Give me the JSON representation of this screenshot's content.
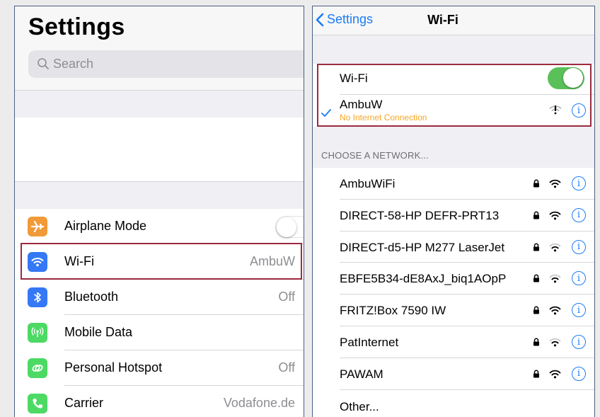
{
  "left": {
    "title": "Settings",
    "search_placeholder": "Search",
    "items": [
      {
        "label": "Airplane Mode",
        "value": "",
        "icon": "airplane-icon",
        "color": "#f19a37",
        "toggle": "off"
      },
      {
        "label": "Wi-Fi",
        "value": "AmbuW",
        "icon": "wifi-icon",
        "color": "#3478f6"
      },
      {
        "label": "Bluetooth",
        "value": "Off",
        "icon": "bluetooth-icon",
        "color": "#3478f6"
      },
      {
        "label": "Mobile Data",
        "value": "",
        "icon": "antenna-icon",
        "color": "#4cd964"
      },
      {
        "label": "Personal Hotspot",
        "value": "Off",
        "icon": "hotspot-icon",
        "color": "#4cd964"
      },
      {
        "label": "Carrier",
        "value": "Vodafone.de",
        "icon": "phone-icon",
        "color": "#4cd964"
      }
    ]
  },
  "right": {
    "back_label": "Settings",
    "title": "Wi-Fi",
    "wifi_label": "Wi-Fi",
    "wifi_toggle": "on",
    "connected": {
      "name": "AmbuW",
      "status": "No Internet Connection",
      "status_color": "#f5a623"
    },
    "section_header": "CHOOSE A NETWORK...",
    "networks": [
      {
        "name": "AmbuWiFi",
        "locked": true,
        "signal": "full"
      },
      {
        "name": "DIRECT-58-HP DEFR-PRT13",
        "locked": true,
        "signal": "full"
      },
      {
        "name": "DIRECT-d5-HP M277 LaserJet",
        "locked": true,
        "signal": "weak"
      },
      {
        "name": "EBFE5B34-dE8AxJ_biq1AOpP",
        "locked": true,
        "signal": "weak"
      },
      {
        "name": "FRITZ!Box 7590 IW",
        "locked": true,
        "signal": "full"
      },
      {
        "name": "PatInternet",
        "locked": true,
        "signal": "weak"
      },
      {
        "name": "PAWAM",
        "locked": true,
        "signal": "full"
      }
    ],
    "other_label": "Other...",
    "info_glyph": "i"
  },
  "colors": {
    "accent": "#1a7cf6",
    "highlight": "#9c2a3e",
    "toggle_on": "#5ac05a"
  }
}
